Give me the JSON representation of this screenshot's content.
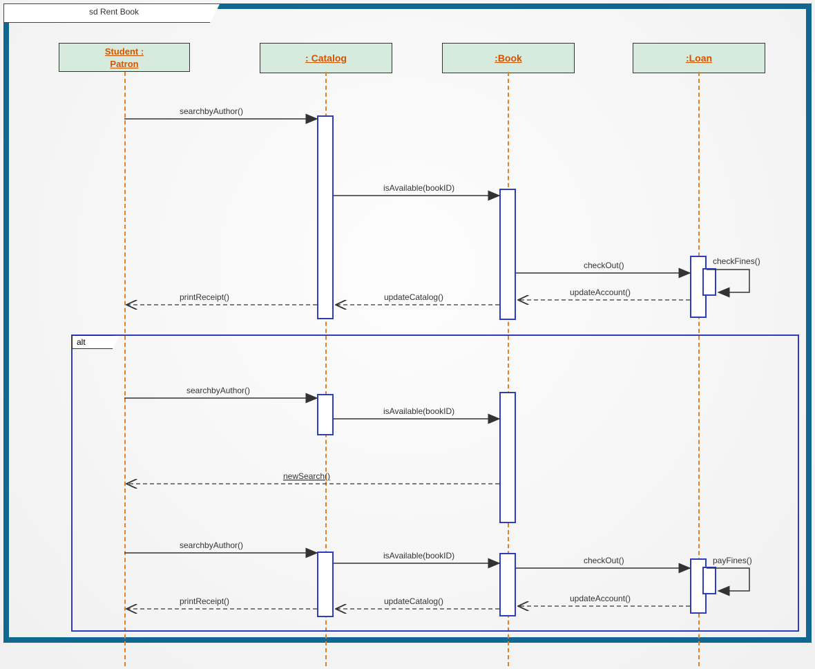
{
  "frame_label": "sd Rent Book",
  "participants": {
    "patron": "Student : Patron",
    "catalog": ": Catalog",
    "book": ":Book",
    "loan": ":Loan"
  },
  "messages": {
    "m1": "searchbyAuthor()",
    "m2": "isAvailable(bookID)",
    "m3": "checkOut()",
    "m4": "checkFines()",
    "m5": "updateAccount()",
    "m6": "updateCatalog()",
    "m7": "printReceipt()",
    "alt_label": "alt",
    "a1": "searchbyAuthor()",
    "a2": "isAvailable(bookID)",
    "a3": "newSearch()",
    "b1": "searchbyAuthor()",
    "b2": "isAvailable(bookID)",
    "b3": "checkOut()",
    "b4": "payFines()",
    "b5": "updateAccount()",
    "b6": "updateCatalog()",
    "b7": "printReceipt()"
  }
}
